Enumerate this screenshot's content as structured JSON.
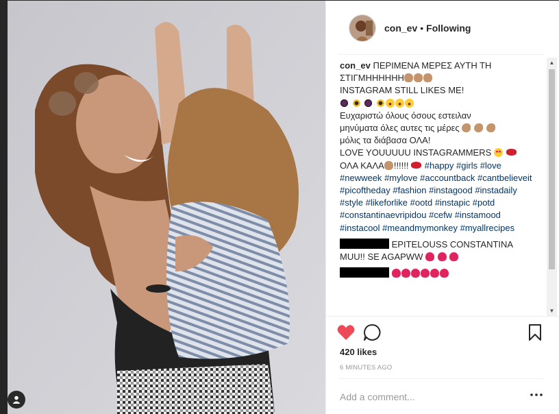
{
  "post": {
    "username": "con_ev",
    "separator": "•",
    "follow_status": "Following",
    "caption_lines": [
      "ΠΕΡΙΜΕΝΑ ΜΕΡΕΣ ΑΥΤΗ ΤΗ",
      "ΣΤΙΓΜΗΗΗΗΗΗ",
      "INSTAGRAM STILL LIKES ME!",
      "Ευχαριστώ όλους όσους εστειλαν",
      "μηνύματα όλες αυτες τις μέρες",
      "μόλις τα διάβασα ΟΛΑ!",
      "LOVE YOUUUUU INSTAGRAMMERS",
      "ΟΛΑ ΚΑΛΑ",
      "!!!!!!"
    ],
    "hashtags": [
      "#happy",
      "#girls",
      "#love",
      "#newweek",
      "#mylove",
      "#accountback",
      "#cantbelieveit",
      "#picoftheday",
      "#fashion",
      "#instagood",
      "#instadaily",
      "#style",
      "#likeforlike",
      "#ootd",
      "#instapic",
      "#potd",
      "#constantinaevripidou",
      "#cefw",
      "#instamood",
      "#instacool",
      "#meandmymonkey",
      "#myallrecipes"
    ],
    "likes": "420 likes",
    "time_ago": "6 MINUTES AGO"
  },
  "comments": [
    {
      "text_lines": [
        "EPITELOUSS CONSTANTINA",
        "MUU!! SE AGAPWW"
      ]
    },
    {
      "text_lines": [
        ""
      ]
    }
  ],
  "add_comment": {
    "placeholder": "Add a comment..."
  },
  "colors": {
    "like_heart": "#ed4956",
    "hashtag": "#003569",
    "muted_text": "#999999"
  },
  "icons": [
    "heart-icon",
    "comment-icon",
    "bookmark-icon",
    "more-options-icon",
    "user-tag-icon"
  ]
}
